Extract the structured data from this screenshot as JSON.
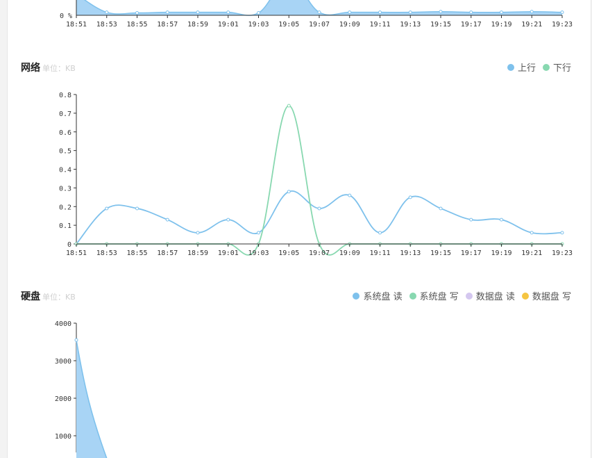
{
  "colors": {
    "upload": "#7ec1ec",
    "download": "#88d8b0",
    "sys_read": "#7ec1ec",
    "sys_write": "#88d8b0",
    "data_read": "#d4c7ef",
    "data_write": "#f5c542",
    "area_fill": "#a8d4f5"
  },
  "x_ticks": [
    "18:51",
    "18:53",
    "18:55",
    "18:57",
    "18:59",
    "19:01",
    "19:03",
    "19:05",
    "19:07",
    "19:09",
    "19:11",
    "19:13",
    "19:15",
    "19:17",
    "19:19",
    "19:21",
    "19:23"
  ],
  "cpu": {
    "y_label": "0 %"
  },
  "network": {
    "title": "网络",
    "unit": "单位：KB",
    "legend": [
      {
        "name": "上行",
        "color_key": "upload"
      },
      {
        "name": "下行",
        "color_key": "download"
      }
    ]
  },
  "disk": {
    "title": "硬盘",
    "unit": "单位：KB",
    "legend": [
      {
        "name": "系统盘 读",
        "color_key": "sys_read"
      },
      {
        "name": "系统盘 写",
        "color_key": "sys_write"
      },
      {
        "name": "数据盘 读",
        "color_key": "data_read"
      },
      {
        "name": "数据盘 写",
        "color_key": "data_write"
      }
    ]
  },
  "chart_data": [
    {
      "type": "area",
      "x": [
        "18:51",
        "18:53",
        "18:55",
        "18:57",
        "18:59",
        "19:01",
        "19:03",
        "19:05",
        "19:07",
        "19:09",
        "19:11",
        "19:13",
        "19:15",
        "19:17",
        "19:19",
        "19:21",
        "19:23"
      ],
      "series": [
        {
          "values": [
            3.5,
            0.5,
            0.4,
            0.5,
            0.5,
            0.5,
            0.4,
            6,
            0.5,
            0.5,
            0.5,
            0.5,
            0.6,
            0.5,
            0.5,
            0.6,
            0.5
          ]
        }
      ],
      "ylabel": "%"
    },
    {
      "type": "line",
      "title": "网络",
      "x": [
        "18:51",
        "18:53",
        "18:55",
        "18:57",
        "18:59",
        "19:01",
        "19:03",
        "19:05",
        "19:07",
        "19:09",
        "19:11",
        "19:13",
        "19:15",
        "19:17",
        "19:19",
        "19:21",
        "19:23"
      ],
      "yticks": [
        "0",
        "0.1",
        "0.2",
        "0.3",
        "0.4",
        "0.5",
        "0.6",
        "0.7",
        "0.8"
      ],
      "ylim": [
        0,
        0.8
      ],
      "series": [
        {
          "name": "上行",
          "values": [
            0,
            0.19,
            0.19,
            0.13,
            0.06,
            0.13,
            0.06,
            0.28,
            0.19,
            0.26,
            0.06,
            0.25,
            0.19,
            0.13,
            0.13,
            0.06,
            0.06
          ]
        },
        {
          "name": "下行",
          "values": [
            0,
            0,
            0,
            0,
            0,
            0,
            0,
            0.74,
            0,
            0,
            0,
            0,
            0,
            0,
            0,
            0,
            0
          ]
        }
      ]
    },
    {
      "type": "area",
      "title": "硬盘",
      "x": [
        "18:51",
        "18:53",
        "18:55",
        "18:57",
        "18:59",
        "19:01",
        "19:03",
        "19:05",
        "19:07",
        "19:09",
        "19:11",
        "19:13",
        "19:15",
        "19:17",
        "19:19",
        "19:21",
        "19:23"
      ],
      "yticks": [
        "1000",
        "2000",
        "3000",
        "4000"
      ],
      "ylim": [
        0,
        4000
      ],
      "series": [
        {
          "name": "系统盘 读",
          "values": [
            3550,
            400
          ]
        }
      ]
    }
  ]
}
